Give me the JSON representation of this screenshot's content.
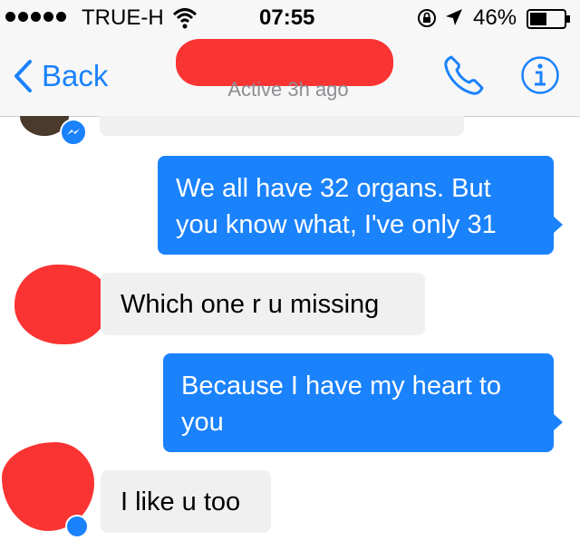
{
  "status_bar": {
    "carrier": "TRUE-H",
    "time": "07:55",
    "battery_percent": "46%",
    "icons": [
      "signal-dots-icon",
      "wifi-icon",
      "rotation-lock-icon",
      "location-arrow-icon",
      "battery-icon"
    ]
  },
  "nav": {
    "back_label": "Back",
    "contact_name": "",
    "active_status": "Active 3h ago",
    "icons": [
      "back-chevron-icon",
      "phone-icon",
      "info-icon"
    ]
  },
  "messages": [
    {
      "direction": "incoming",
      "text": "",
      "partially_hidden": true
    },
    {
      "direction": "outgoing",
      "lines": [
        "We all have 32 organs. But",
        "you know what, I've only 31"
      ]
    },
    {
      "direction": "incoming",
      "lines": [
        "Which one r u missing"
      ]
    },
    {
      "direction": "outgoing",
      "lines": [
        "Because I have my heart to",
        "you"
      ]
    },
    {
      "direction": "incoming",
      "lines": [
        "I like u too"
      ]
    }
  ],
  "colors": {
    "accent": "#1a82fb",
    "incoming_bubble": "#f1f0f0",
    "redaction": "#fa3333",
    "nav_background": "#f7f7f8",
    "secondary_text": "#8e8e93"
  }
}
